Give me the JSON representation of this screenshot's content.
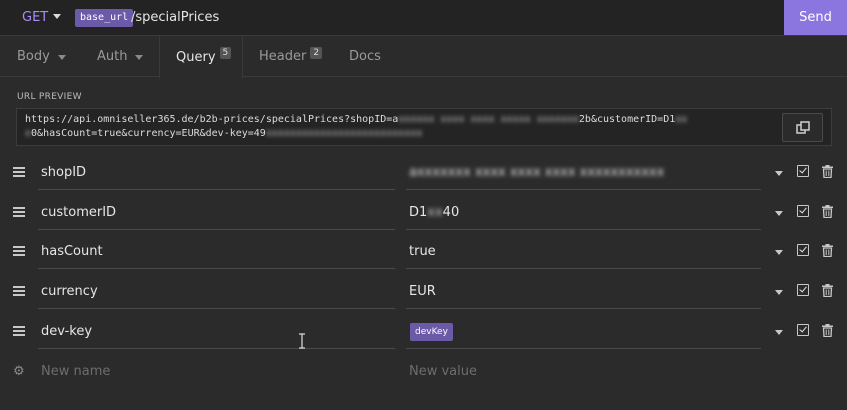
{
  "request": {
    "method": "GET",
    "env_tag": "base_url",
    "path": "/specialPrices",
    "send_label": "Send"
  },
  "tabs": [
    {
      "label": "Body",
      "count": ""
    },
    {
      "label": "Auth",
      "count": ""
    },
    {
      "label": "Query",
      "count": "5"
    },
    {
      "label": "Header",
      "count": "2"
    },
    {
      "label": "Docs",
      "count": ""
    }
  ],
  "url_preview": {
    "label": "URL PREVIEW",
    "text_line1": "https://api.omniseller365.de/b2b-prices/specialPrices?shopID=a",
    "text_line1_tail": "2b&customerID=D1",
    "text_line2": "0&hasCount=true&currency=EUR&dev-key=49"
  },
  "params": [
    {
      "name": "shopID",
      "value": "",
      "value_tag": ""
    },
    {
      "name": "customerID",
      "value": "D1",
      "value_suffix": "40",
      "value_tag": ""
    },
    {
      "name": "hasCount",
      "value": "true",
      "value_tag": ""
    },
    {
      "name": "currency",
      "value": "EUR",
      "value_tag": ""
    },
    {
      "name": "dev-key",
      "value": "",
      "value_tag": "devKey"
    }
  ],
  "new_row": {
    "name_placeholder": "New name",
    "value_placeholder": "New value"
  },
  "colors": {
    "accent": "#8b76e0",
    "tag": "#6b5aa8",
    "background": "#2b2b2b"
  }
}
